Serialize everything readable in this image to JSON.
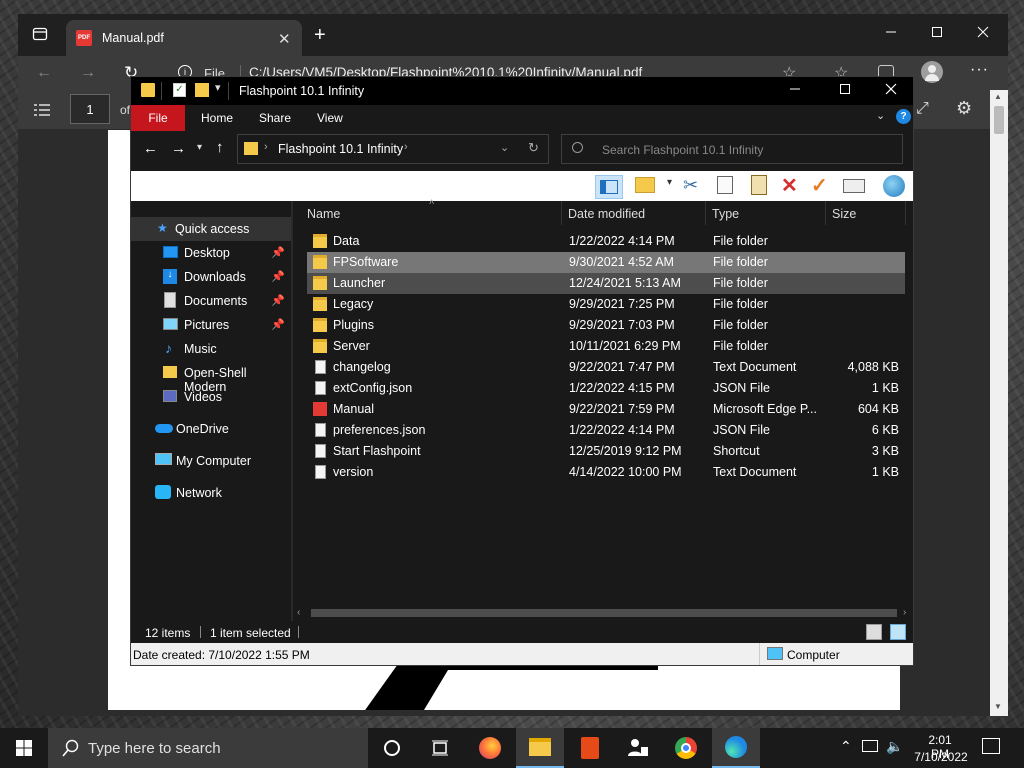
{
  "edge": {
    "tab_title": "Manual.pdf",
    "address_prefix": "File",
    "address": "C:/Users/VM5/Desktop/Flashpoint%2010.1%20Infinity/Manual.pdf",
    "page_number": "1",
    "page_of": "of"
  },
  "explorer": {
    "title": "Flashpoint 10.1 Infinity",
    "ribbon_tabs": [
      "File",
      "Home",
      "Share",
      "View"
    ],
    "breadcrumb": "Flashpoint 10.1 Infinity",
    "search_placeholder": "Search Flashpoint 10.1 Infinity",
    "nav": {
      "quick_access": "Quick access",
      "items": [
        {
          "label": "Desktop",
          "icon": "desktop-icon",
          "pinned": true
        },
        {
          "label": "Downloads",
          "icon": "downloads-icon",
          "pinned": true
        },
        {
          "label": "Documents",
          "icon": "documents-icon",
          "pinned": true
        },
        {
          "label": "Pictures",
          "icon": "pictures-icon",
          "pinned": true
        },
        {
          "label": "Music",
          "icon": "music-icon",
          "pinned": false
        },
        {
          "label": "Open-Shell Modern",
          "icon": "folder-icon",
          "pinned": false
        },
        {
          "label": "Videos",
          "icon": "videos-icon",
          "pinned": false
        }
      ],
      "onedrive": "OneDrive",
      "my_computer": "My Computer",
      "network": "Network"
    },
    "columns": {
      "name": "Name",
      "date": "Date modified",
      "type": "Type",
      "size": "Size"
    },
    "files": [
      {
        "name": "Data",
        "date": "1/22/2022 4:14 PM",
        "type": "File folder",
        "size": "",
        "icon": "folder-icon"
      },
      {
        "name": "FPSoftware",
        "date": "9/30/2021 4:52 AM",
        "type": "File folder",
        "size": "",
        "icon": "folder-icon"
      },
      {
        "name": "Launcher",
        "date": "12/24/2021 5:13 AM",
        "type": "File folder",
        "size": "",
        "icon": "folder-icon"
      },
      {
        "name": "Legacy",
        "date": "9/29/2021 7:25 PM",
        "type": "File folder",
        "size": "",
        "icon": "folder-icon"
      },
      {
        "name": "Plugins",
        "date": "9/29/2021 7:03 PM",
        "type": "File folder",
        "size": "",
        "icon": "folder-icon"
      },
      {
        "name": "Server",
        "date": "10/11/2021 6:29 PM",
        "type": "File folder",
        "size": "",
        "icon": "folder-icon"
      },
      {
        "name": "changelog",
        "date": "9/22/2021 7:47 PM",
        "type": "Text Document",
        "size": "4,088 KB",
        "icon": "text-file-icon"
      },
      {
        "name": "extConfig.json",
        "date": "1/22/2022 4:15 PM",
        "type": "JSON File",
        "size": "1 KB",
        "icon": "json-file-icon"
      },
      {
        "name": "Manual",
        "date": "9/22/2021 7:59 PM",
        "type": "Microsoft Edge P...",
        "size": "604 KB",
        "icon": "pdf-file-icon"
      },
      {
        "name": "preferences.json",
        "date": "1/22/2022 4:14 PM",
        "type": "JSON File",
        "size": "6 KB",
        "icon": "json-file-icon"
      },
      {
        "name": "Start Flashpoint",
        "date": "12/25/2019 9:12 PM",
        "type": "Shortcut",
        "size": "3 KB",
        "icon": "shortcut-icon"
      },
      {
        "name": "version",
        "date": "4/14/2022 10:00 PM",
        "type": "Text Document",
        "size": "1 KB",
        "icon": "text-file-icon"
      }
    ],
    "status": {
      "items": "12 items",
      "selected": "1 item selected"
    },
    "details": {
      "created": "Date created: 7/10/2022 1:55 PM",
      "location": "Computer"
    }
  },
  "taskbar": {
    "search_placeholder": "Type here to search",
    "time": "2:01 PM",
    "date": "7/10/2022"
  },
  "colors": {
    "file_tab": "#c4161c",
    "folder": "#f5c94a",
    "selection": "#777777",
    "accent_blue": "#1e88e5"
  }
}
